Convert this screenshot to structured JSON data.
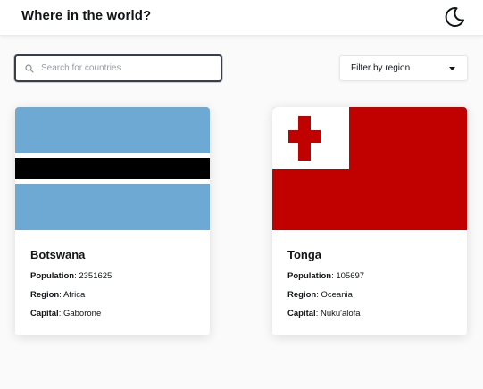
{
  "header": {
    "title": "Where in the world?",
    "theme_icon": "moon-icon"
  },
  "search": {
    "placeholder": "Search for countries",
    "value": "",
    "icon": "search-icon"
  },
  "filter": {
    "label": "Filter by region",
    "icon": "caret-down-icon"
  },
  "labels": {
    "population": "Population",
    "region": "Region",
    "capital": "Capital"
  },
  "countries": [
    {
      "name": "Botswana",
      "population": "2351625",
      "region": "Africa",
      "capital": "Gaborone",
      "flag_colors": {
        "blue": "#6DA9D2",
        "white": "#FFFFFF",
        "black": "#000000"
      }
    },
    {
      "name": "Tonga",
      "population": "105697",
      "region": "Oceania",
      "capital": "Nuku'alofa",
      "flag_colors": {
        "red": "#C10000",
        "white": "#FFFFFF"
      }
    }
  ]
}
